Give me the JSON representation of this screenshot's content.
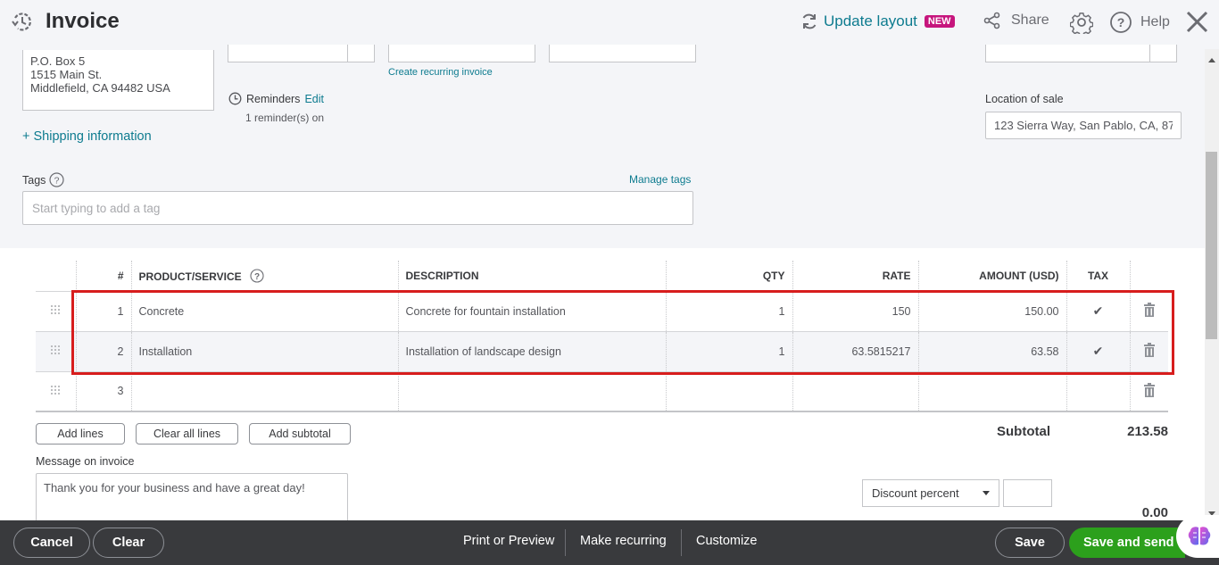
{
  "header": {
    "title": "Invoice",
    "update_layout": "Update layout",
    "new_badge": "NEW",
    "share": "Share",
    "help": "Help"
  },
  "billing": {
    "address_lines": [
      "P.O. Box 5",
      "1515 Main St.",
      "Middlefield, CA  94482 USA"
    ],
    "shipping_link": "+ Shipping information"
  },
  "recurring_link": "Create recurring invoice",
  "reminders": {
    "title": "Reminders",
    "edit": "Edit",
    "status": "1 reminder(s) on"
  },
  "location_of_sale": {
    "label": "Location of sale",
    "value": "123 Sierra Way, San Pablo, CA, 87"
  },
  "tags": {
    "label": "Tags",
    "manage": "Manage tags",
    "placeholder": "Start typing to add a tag"
  },
  "table": {
    "headers": {
      "num": "#",
      "product": "PRODUCT/SERVICE",
      "description": "DESCRIPTION",
      "qty": "QTY",
      "rate": "RATE",
      "amount": "AMOUNT (USD)",
      "tax": "TAX"
    },
    "rows": [
      {
        "num": "1",
        "product": "Concrete",
        "description": "Concrete for fountain installation",
        "qty": "1",
        "rate": "150",
        "amount": "150.00",
        "tax": "✔"
      },
      {
        "num": "2",
        "product": "Installation",
        "description": "Installation of landscape design",
        "qty": "1",
        "rate": "63.5815217",
        "amount": "63.58",
        "tax": "✔"
      },
      {
        "num": "3",
        "product": "",
        "description": "",
        "qty": "",
        "rate": "",
        "amount": "",
        "tax": ""
      }
    ]
  },
  "actions": {
    "add_lines": "Add lines",
    "clear_all_lines": "Clear all lines",
    "add_subtotal": "Add subtotal"
  },
  "totals": {
    "subtotal_label": "Subtotal",
    "subtotal_value": "213.58",
    "discount_type": "Discount percent",
    "discount_amount": "0.00"
  },
  "message": {
    "label": "Message on invoice",
    "value": "Thank you for your business and have a great day!"
  },
  "footer": {
    "cancel": "Cancel",
    "clear": "Clear",
    "print_preview": "Print or Preview",
    "make_recurring": "Make recurring",
    "customize": "Customize",
    "save": "Save",
    "save_and_send": "Save and send"
  },
  "colors": {
    "accent_link": "#0d7b8f",
    "badge": "#c6157d",
    "primary_green": "#2ca01c",
    "highlight_red": "#d71d1d",
    "footer_bg": "#393a3d"
  }
}
